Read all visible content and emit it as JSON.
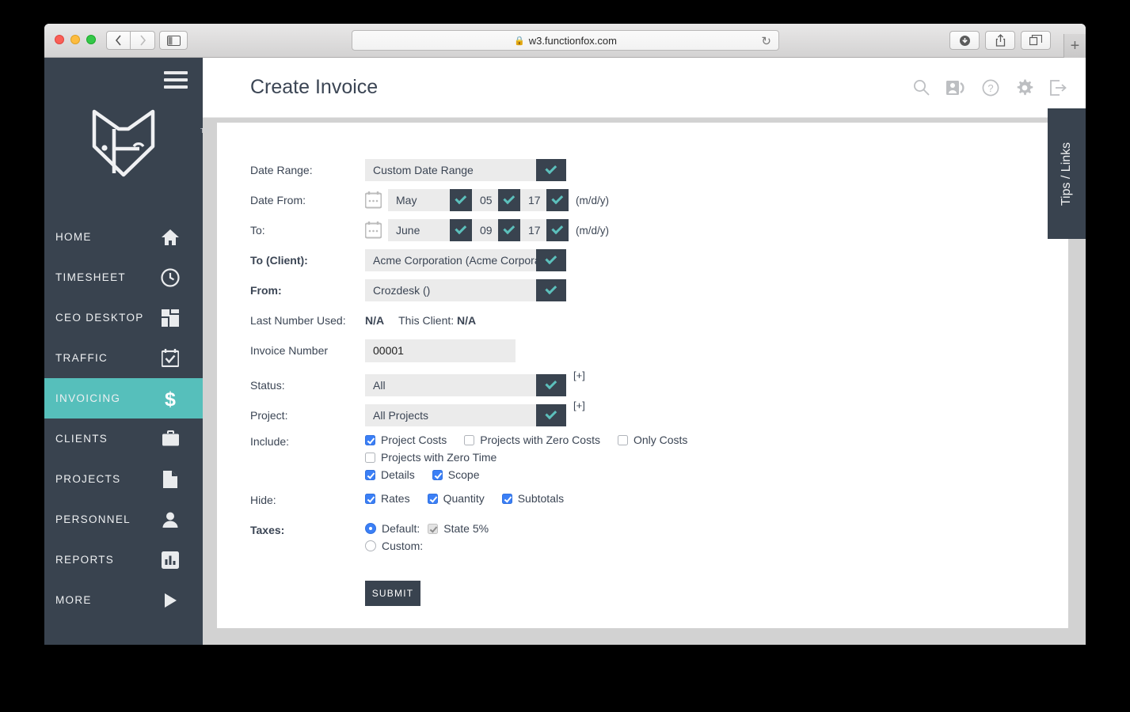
{
  "browser": {
    "url": "w3.functionfox.com",
    "lock_icon": "lock-icon",
    "back_icon": "chevron-left-icon",
    "forward_icon": "chevron-right-icon",
    "sidebar_icon": "sidebar-toggle-icon",
    "reload_icon": "reload-icon",
    "download_icon": "download-icon",
    "share_icon": "share-icon",
    "tabs_icon": "show-tabs-icon",
    "newtab_label": "+"
  },
  "sidebar": {
    "menu_icon": "hamburger-icon",
    "logo_name": "functionfox-fox-logo",
    "trademark": "TM",
    "items": [
      {
        "label": "HOME",
        "icon": "home-icon",
        "active": false
      },
      {
        "label": "TIMESHEET",
        "icon": "clock-icon",
        "active": false
      },
      {
        "label": "CEO DESKTOP",
        "icon": "dashboard-icon",
        "active": false
      },
      {
        "label": "TRAFFIC",
        "icon": "calendar-check-icon",
        "active": false
      },
      {
        "label": "INVOICING",
        "icon": "dollar-icon",
        "active": true
      },
      {
        "label": "CLIENTS",
        "icon": "briefcase-icon",
        "active": false
      },
      {
        "label": "PROJECTS",
        "icon": "document-icon",
        "active": false
      },
      {
        "label": "PERSONNEL",
        "icon": "person-icon",
        "active": false
      },
      {
        "label": "REPORTS",
        "icon": "bar-chart-icon",
        "active": false
      },
      {
        "label": "MORE",
        "icon": "play-triangle-icon",
        "active": false
      }
    ],
    "accent_color": "#56bfbb",
    "background_color": "#39434f"
  },
  "header": {
    "title": "Create Invoice",
    "icons": [
      "search-icon",
      "contact-card-icon",
      "help-circle-icon",
      "gear-icon",
      "logout-icon"
    ]
  },
  "tips_tab": {
    "label": "Tips / Links"
  },
  "form": {
    "date_range": {
      "label": "Date Range:",
      "value": "Custom Date Range"
    },
    "date_from": {
      "label": "Date From:",
      "calendar_icon": "calendar-icon",
      "month": "May",
      "day": "05",
      "year": "17",
      "format": "(m/d/y)"
    },
    "date_to": {
      "label": "To:",
      "calendar_icon": "calendar-icon",
      "month": "June",
      "day": "09",
      "year": "17",
      "format": "(m/d/y)"
    },
    "to_client": {
      "label": "To (Client):",
      "value": "Acme Corporation (Acme Corporat"
    },
    "from": {
      "label": "From:",
      "value": "Crozdesk ()"
    },
    "last_number": {
      "label": "Last Number Used:",
      "value": "N/A",
      "client_label": "This Client:",
      "client_value": "N/A"
    },
    "invoice_number": {
      "label": "Invoice Number",
      "value": "00001"
    },
    "status": {
      "label": "Status:",
      "value": "All",
      "add_label": "[+]"
    },
    "project": {
      "label": "Project:",
      "value": "All Projects",
      "add_label": "[+]"
    },
    "include": {
      "label": "Include:",
      "options": [
        {
          "label": "Project Costs",
          "checked": true
        },
        {
          "label": "Projects with Zero Costs",
          "checked": false
        },
        {
          "label": "Only Costs",
          "checked": false
        },
        {
          "label": "Projects with Zero Time",
          "checked": false
        },
        {
          "label": "Details",
          "checked": true
        },
        {
          "label": "Scope",
          "checked": true
        }
      ]
    },
    "hide": {
      "label": "Hide:",
      "options": [
        {
          "label": "Rates",
          "checked": true
        },
        {
          "label": "Quantity",
          "checked": true
        },
        {
          "label": "Subtotals",
          "checked": true
        }
      ]
    },
    "taxes": {
      "label": "Taxes:",
      "default_label": "Default:",
      "default_selected": true,
      "state_label": "State 5%",
      "state_checked": true,
      "custom_label": "Custom:",
      "custom_selected": false
    },
    "submit_label": "SUBMIT"
  }
}
